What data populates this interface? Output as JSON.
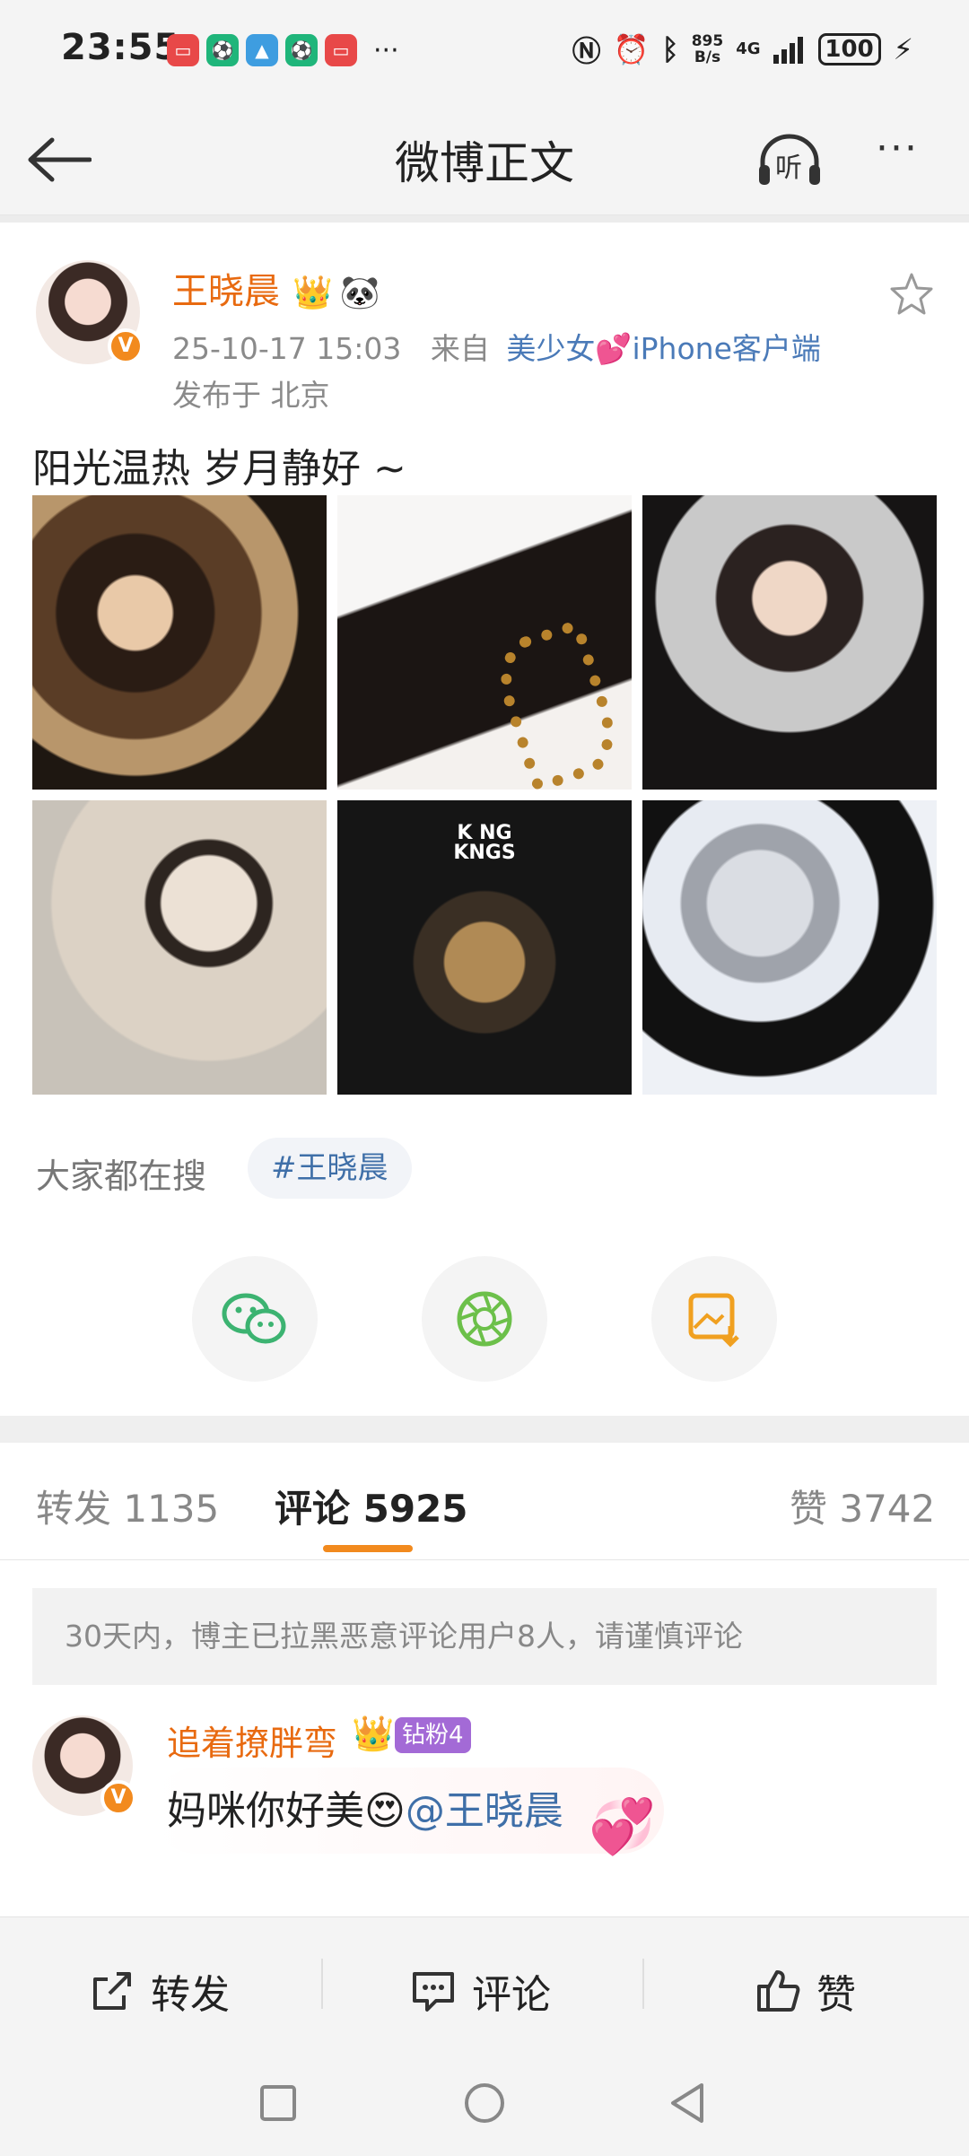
{
  "status_bar": {
    "time": "23:55",
    "more": "···",
    "net_speed_top": "895",
    "net_speed_bottom": "B/s",
    "network": "4G",
    "battery": "100"
  },
  "nav": {
    "title": "微博正文",
    "listen_label": "听",
    "more": "···"
  },
  "post": {
    "username": "王晓晨",
    "time": "25-10-17 15:03",
    "source_prefix": "来自",
    "source": "美少女💕iPhone客户端",
    "location": "发布于 北京",
    "text": "阳光温热 岁月静好 ~",
    "photo5_line1": "K NG",
    "photo5_line2": "KNGS"
  },
  "hot_search": {
    "label": "大家都在搜",
    "tag": "#王晓晨"
  },
  "tabs": {
    "repost": "转发 1135",
    "comment": "评论 5925",
    "like": "赞 3742"
  },
  "notice": "30天内，博主已拉黑恶意评论用户8人，请谨慎评论",
  "comment": {
    "username": "追着撩胖弯",
    "badge": "钻粉4",
    "text_main": "妈咪你好美😍",
    "mention": "@王晓晨"
  },
  "actions": {
    "repost": "转发",
    "comment": "评论",
    "like": "赞"
  },
  "colors": {
    "accent": "#f28a1e",
    "username": "#e86a10",
    "link": "#3f6fa8"
  }
}
